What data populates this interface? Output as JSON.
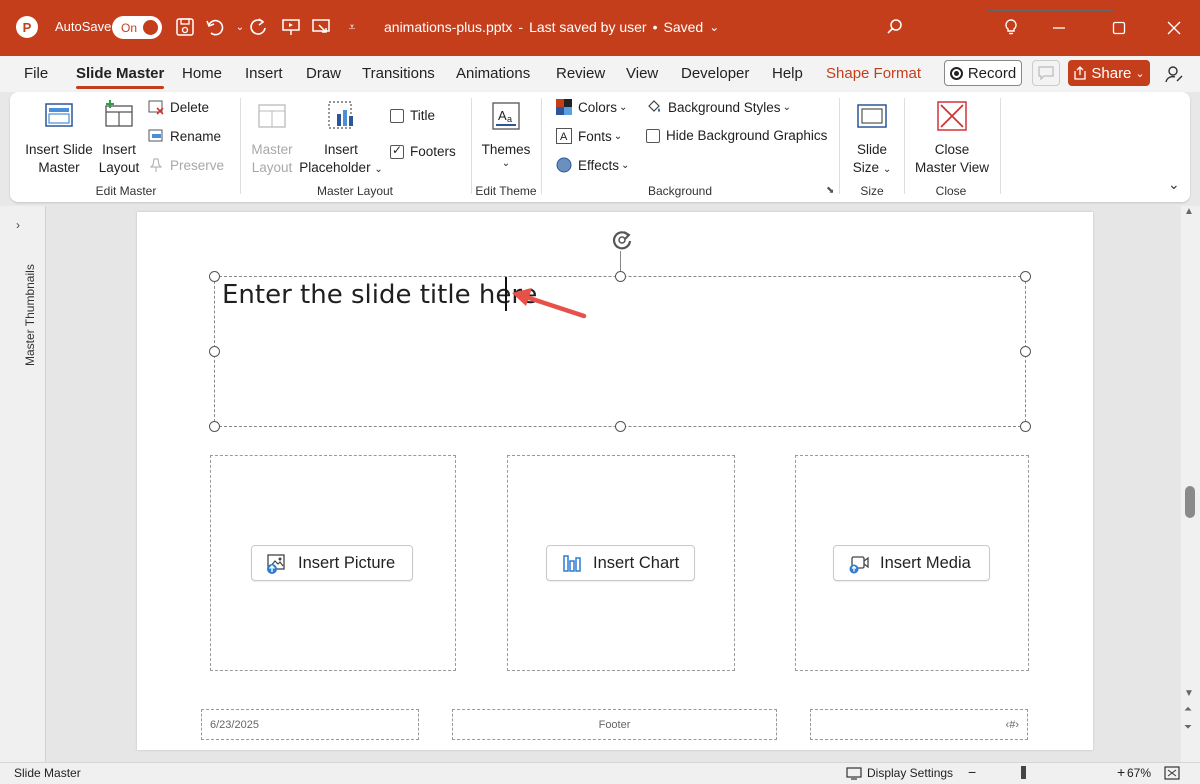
{
  "titlebar": {
    "logo": "P",
    "autosave_label": "AutoSave",
    "autosave_state": "On",
    "doc_name": "animations-plus.pptx",
    "separator": "•",
    "saved_by": "Last saved by user",
    "saved_status": "Saved"
  },
  "menu": {
    "tabs": [
      "File",
      "Slide Master",
      "Home",
      "Insert",
      "Draw",
      "Transitions",
      "Animations",
      "Review",
      "View",
      "Developer",
      "Help",
      "Shape Format"
    ],
    "record_label": "Record",
    "share_label": "Share"
  },
  "ribbon": {
    "edit_master": {
      "insert_slide_master_l1": "Insert Slide",
      "insert_slide_master_l2": "Master",
      "insert_layout_l1": "Insert",
      "insert_layout_l2": "Layout",
      "delete": "Delete",
      "rename": "Rename",
      "preserve": "Preserve",
      "group": "Edit Master"
    },
    "master_layout": {
      "master_layout_l1": "Master",
      "master_layout_l2": "Layout",
      "insert_placeholder_l1": "Insert",
      "insert_placeholder_l2": "Placeholder",
      "title": "Title",
      "footers": "Footers",
      "group": "Master Layout"
    },
    "edit_theme": {
      "themes": "Themes",
      "group": "Edit Theme"
    },
    "background": {
      "colors": "Colors",
      "fonts": "Fonts",
      "effects": "Effects",
      "background_styles": "Background Styles",
      "hide_background_graphics": "Hide Background Graphics",
      "group": "Background"
    },
    "size": {
      "slide_size_l1": "Slide",
      "slide_size_l2": "Size",
      "group": "Size"
    },
    "close": {
      "close_l1": "Close",
      "close_l2": "Master View",
      "group": "Close"
    }
  },
  "left_pane": {
    "label": "Master Thumbnails"
  },
  "slide": {
    "title_text": "Enter the slide title here",
    "insert_picture": "Insert Picture",
    "insert_chart": "Insert Chart",
    "insert_media": "Insert Media",
    "footer_date": "6/23/2025",
    "footer_text": "Footer",
    "footer_number": "‹#›"
  },
  "statusbar": {
    "view_name": "Slide Master",
    "display_settings": "Display Settings",
    "zoom_minus": "−",
    "zoom_plus": "+",
    "zoom_level": "67%"
  },
  "colors": {
    "accent": "#c43e1c",
    "annotation_arrow": "#e8504a"
  }
}
